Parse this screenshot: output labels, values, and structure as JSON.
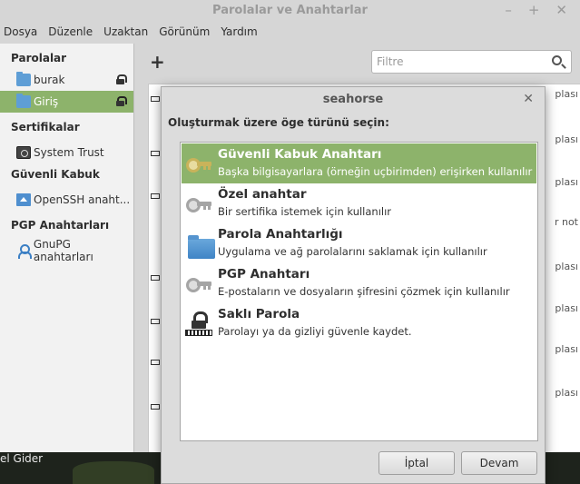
{
  "window": {
    "title": "Parolalar ve Anahtarlar",
    "controls": [
      "–",
      "+",
      "✕"
    ]
  },
  "menu": [
    "Dosya",
    "Düzenle",
    "Uzaktan",
    "Görünüm",
    "Yardım"
  ],
  "sidebar": {
    "sections": [
      {
        "header": "Parolalar",
        "items": [
          {
            "label": "burak",
            "icon": "folder-icon",
            "locked": true
          },
          {
            "label": "Giriş",
            "icon": "folder-icon",
            "locked": true,
            "selected": true
          }
        ]
      },
      {
        "header": "Sertifikalar",
        "items": [
          {
            "label": "System Trust",
            "icon": "certificate-icon"
          }
        ]
      },
      {
        "header": "Güvenli Kabuk",
        "items": [
          {
            "label": "OpenSSH anaht...",
            "icon": "home-folder-icon"
          }
        ]
      },
      {
        "header": "PGP Anahtarları",
        "items": [
          {
            "label": "GnuPG anahtarları",
            "icon": "person-icon"
          }
        ]
      }
    ]
  },
  "toolbar": {
    "add_label": "+",
    "filter_placeholder": "Filtre"
  },
  "background_list": {
    "right_texts": [
      "plası",
      "plası",
      "plası",
      "r not",
      "plası",
      "plası",
      "plası",
      "plası"
    ]
  },
  "desktop": {
    "bottom_text": "el Gider"
  },
  "dialog": {
    "title": "seahorse",
    "close": "✕",
    "prompt": "Oluşturmak üzere öge türünü seçin:",
    "options": [
      {
        "title": "Güvenli Kabuk Anahtarı",
        "desc": "Başka bilgisayarlara (örneğin uçbirimden) erişirken kullanılır",
        "icon": "key-icon",
        "selected": true
      },
      {
        "title": "Özel anahtar",
        "desc": "Bir sertifika istemek için kullanılır",
        "icon": "key-icon"
      },
      {
        "title": "Parola Anahtarlığı",
        "desc": "Uygulama ve ağ parolalarını saklamak için kullanılır",
        "icon": "folder-icon"
      },
      {
        "title": "PGP Anahtarı",
        "desc": "E-postaların ve dosyaların şifresini çözmek için kullanılır",
        "icon": "key-icon"
      },
      {
        "title": "Saklı Parola",
        "desc": "Parolayı ya da gizliyi güvenle kaydet.",
        "icon": "password-icon"
      }
    ],
    "cancel_label": "İptal",
    "continue_label": "Devam"
  },
  "colors": {
    "selection": "#8db36b",
    "window_bg": "#d6d6d6"
  }
}
